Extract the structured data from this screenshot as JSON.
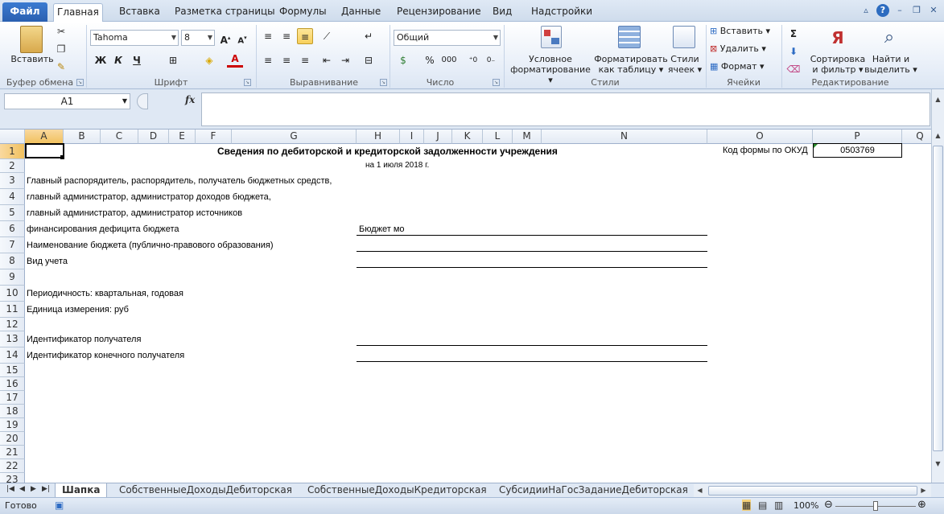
{
  "tabs": {
    "file": "Файл",
    "items": [
      "Главная",
      "Вставка",
      "Разметка страницы",
      "Формулы",
      "Данные",
      "Рецензирование",
      "Вид",
      "Надстройки"
    ]
  },
  "ribbon": {
    "clipboard": {
      "paste": "Вставить",
      "label": "Буфер обмена"
    },
    "font": {
      "name": "Tahoma",
      "size": "8",
      "bold": "Ж",
      "italic": "К",
      "underline": "Ч",
      "label": "Шрифт"
    },
    "alignment": {
      "label": "Выравнивание"
    },
    "number": {
      "format": "Общий",
      "percent": "%",
      "thousands": "000",
      "label": "Число"
    },
    "styles": {
      "conditional": "Условное",
      "conditional2": "форматирование",
      "table": "Форматировать",
      "table2": "как таблицу",
      "cell": "Стили",
      "cell2": "ячеек",
      "label": "Стили"
    },
    "cells": {
      "insert": "Вставить",
      "delete": "Удалить",
      "format": "Формат",
      "label": "Ячейки"
    },
    "editing": {
      "sigma": "Σ",
      "sort": "Сортировка",
      "sort2": "и фильтр",
      "find": "Найти и",
      "find2": "выделить",
      "label": "Редактирование"
    }
  },
  "formula_bar": {
    "name_box": "A1",
    "fx": "fx",
    "value": ""
  },
  "columns": [
    "A",
    "B",
    "C",
    "D",
    "E",
    "F",
    "G",
    "H",
    "I",
    "J",
    "K",
    "L",
    "M",
    "N",
    "O",
    "P",
    "Q"
  ],
  "rows": [
    "1",
    "2",
    "3",
    "4",
    "5",
    "6",
    "7",
    "8",
    "9",
    "10",
    "11",
    "12",
    "13",
    "14",
    "15",
    "16",
    "17",
    "18",
    "19",
    "20",
    "21",
    "22",
    "23"
  ],
  "sheet": {
    "title": "Сведения по дебиторской и кредиторской задолженности учреждения",
    "date": "на  1 июля 2018 г.",
    "okud_label": "Код формы по ОКУД",
    "okud_value": "0503769",
    "r3": "Главный распорядитель, распорядитель, получатель бюджетных средств,",
    "r4": "главный администратор, администратор доходов бюджета,",
    "r5": "главный администратор, администратор источников",
    "r6": "финансирования дефицита бюджета",
    "r6_value": "Бюджет мо",
    "r7": "Наименование бюджета  (публично-правового образования)",
    "r8": "Вид учета",
    "r10": "Периодичность:  квартальная, годовая",
    "r11": "Единица измерения: руб",
    "r13": "Идентификатор получателя",
    "r14": "Идентификатор конечного получателя"
  },
  "sheet_tabs": [
    "Шапка",
    "СобственныеДоходыДебиторская",
    "СобственныеДоходыКредиторская",
    "СубсидииНаГосЗаданиеДебиторская"
  ],
  "status": {
    "ready": "Готово",
    "zoom": "100%"
  }
}
